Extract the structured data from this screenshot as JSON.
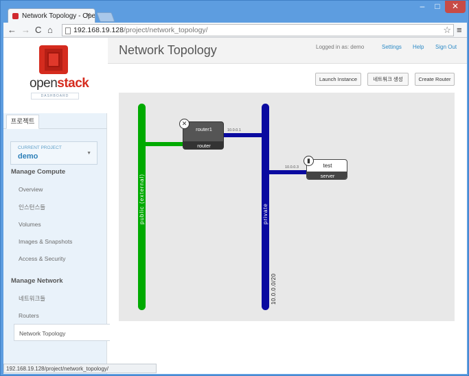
{
  "browser": {
    "tab_title": "Network Topology - Ope",
    "tab_close": "×",
    "window_controls": {
      "minimize": "–",
      "maximize": "□",
      "close": "✕"
    },
    "nav": {
      "back": "←",
      "forward": "→",
      "reload": "C",
      "home": "⌂"
    },
    "url_host": "192.168.19.128",
    "url_path": "/project/network_topology/",
    "star": "☆",
    "menu": "≡",
    "status_url": "192.168.19.128/project/network_topology/"
  },
  "sidebar": {
    "brand_open": "open",
    "brand_stack": "stack",
    "brand_sub": "DASHBOARD",
    "tab": "프로젝트",
    "current_project_label": "CURRENT PROJECT",
    "current_project": "demo",
    "project_caret": "▼",
    "sections": [
      {
        "title": "Manage Compute",
        "items": [
          "Overview",
          "인스턴스들",
          "Volumes",
          "Images & Snapshots",
          "Access & Security"
        ]
      },
      {
        "title": "Manage Network",
        "items": [
          "네트워크들",
          "Routers",
          "Network Topology"
        ]
      }
    ]
  },
  "header": {
    "title": "Network Topology",
    "logged_in": "Logged in as: demo",
    "settings": "Settings",
    "help": "Help",
    "sign_out": "Sign Out"
  },
  "actions": {
    "launch_instance": "Launch Instance",
    "create_network": "네트워크 생성",
    "create_router": "Create Router"
  },
  "topology": {
    "networks": [
      {
        "name": "public (external)",
        "color": "#00aa00"
      },
      {
        "name": "private",
        "color": "#0a0aa0",
        "cidr": "10.0.0.0/20"
      }
    ],
    "router": {
      "name": "router1",
      "type": "router",
      "ip": "10.0.0.1",
      "icon": "router-icon"
    },
    "server": {
      "name": "test",
      "type": "server",
      "ip": "10.0.0.3",
      "icon": "server-icon"
    }
  }
}
